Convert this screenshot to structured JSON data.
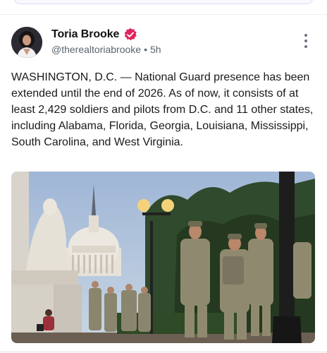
{
  "post": {
    "author_name": "Toria Brooke",
    "handle": "@therealtoriabrooke",
    "separator": "•",
    "time": "5h",
    "text": "WASHINGTON, D.C. — National Guard presence has been extended until the end of 2026. As of now, it consists of at least 2,429 soldiers and pilots from D.C. and 11 other states, including Alabama, Florida, Georgia, Louisiana, Mississippi, South Carolina, and West Virginia."
  },
  "icons": {
    "verified": "verified-badge-icon",
    "more": "more-vertical-icon"
  },
  "colors": {
    "verified_badge": "#e0245e",
    "text": "#1a1a1a",
    "handle": "#5b6470"
  }
}
